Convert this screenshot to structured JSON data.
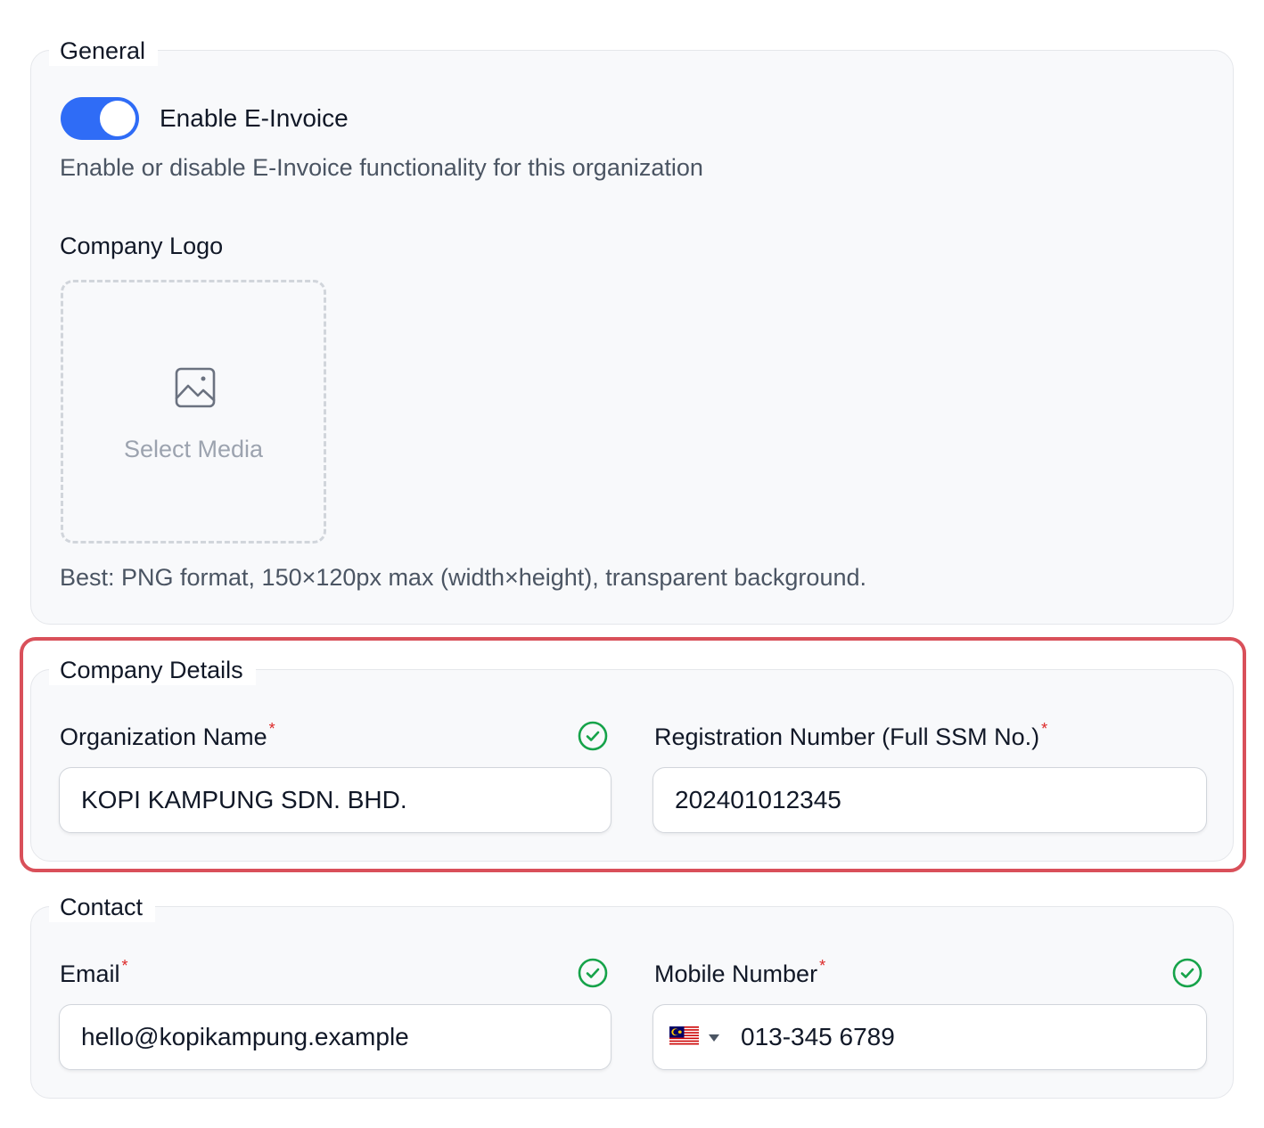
{
  "general": {
    "legend": "General",
    "toggle": {
      "label": "Enable E-Invoice",
      "enabled": true,
      "description": "Enable or disable E-Invoice functionality for this organization"
    },
    "logo": {
      "label": "Company Logo",
      "select_label": "Select Media",
      "hint": "Best: PNG format, 150×120px max (width×height), transparent background."
    }
  },
  "company_details": {
    "legend": "Company Details",
    "organization_name": {
      "label": "Organization Name",
      "required_mark": "*",
      "value": "KOPI KAMPUNG SDN. BHD.",
      "valid": true
    },
    "registration_number": {
      "label": "Registration Number (Full SSM No.)",
      "required_mark": "*",
      "value": "202401012345"
    }
  },
  "contact": {
    "legend": "Contact",
    "email": {
      "label": "Email",
      "required_mark": "*",
      "value": "hello@kopikampung.example",
      "valid": true
    },
    "mobile": {
      "label": "Mobile Number",
      "required_mark": "*",
      "country_flag": "malaysia-flag-icon",
      "value": "013-345 6789",
      "valid": true
    }
  },
  "colors": {
    "toggle_on": "#2f6cf6",
    "valid_check": "#16a34a",
    "required": "#dc2626",
    "highlight_border": "#d9505a"
  }
}
